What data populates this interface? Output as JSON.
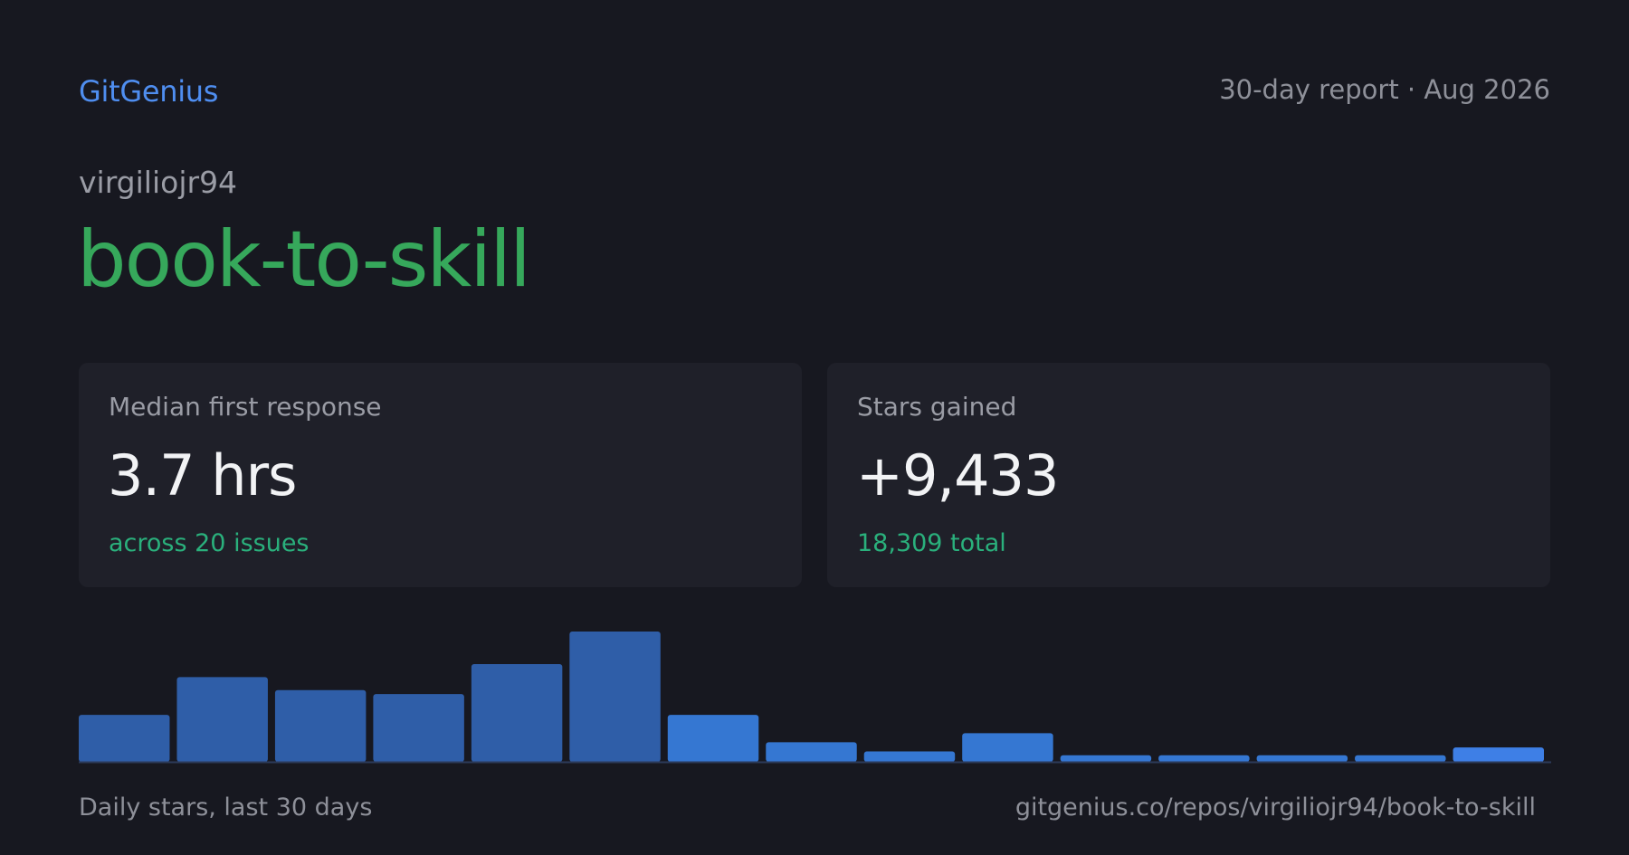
{
  "header": {
    "brand": "GitGenius",
    "report_meta": "30-day report · Aug 2026"
  },
  "repo": {
    "owner": "virgiliojr94",
    "name": "book-to-skill"
  },
  "cards": [
    {
      "label": "Median first response",
      "value": "3.7 hrs",
      "sub": "across 20 issues"
    },
    {
      "label": "Stars gained",
      "value": "+9,433",
      "sub": "18,309 total"
    }
  ],
  "footer": {
    "caption": "Daily stars, last 30 days",
    "url": "gitgenius.co/repos/virgiliojr94/book-to-skill"
  },
  "colors": {
    "background": "#171820",
    "brand": "#4f8ef0",
    "repo_name": "#36a85b",
    "accent_green": "#2ab07c",
    "bar_past": "#2f5ea8",
    "bar_recent": "#3577d2",
    "bar_latest": "#3e7fe6"
  },
  "chart_data": {
    "type": "bar",
    "title": "",
    "xlabel": "",
    "ylabel": "",
    "values": [
      36,
      65,
      55,
      52,
      75,
      100,
      36,
      15,
      8,
      22,
      5,
      5,
      5,
      5,
      11
    ],
    "highlight_from_index": 6,
    "ylim": [
      0,
      100
    ],
    "grid": false,
    "y_units": "relative scale (no axis printed)"
  }
}
